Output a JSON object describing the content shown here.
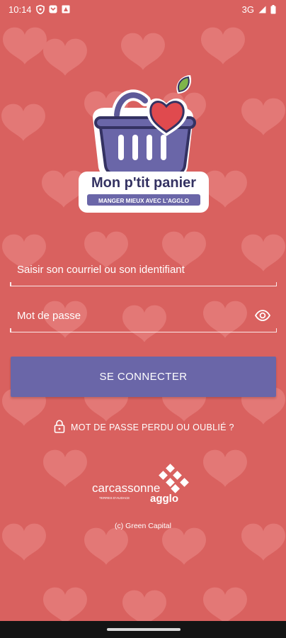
{
  "status_bar": {
    "time": "10:14",
    "network": "3G",
    "left_icons": [
      "shield-icon",
      "notification-icon",
      "app-icon"
    ],
    "right_icons": [
      "signal-icon",
      "battery-icon"
    ]
  },
  "logo": {
    "title": "Mon p'tit panier",
    "tagline": "MANGER MIEUX AVEC L'AGGLO"
  },
  "login": {
    "identifier_placeholder": "Saisir son courriel ou son identifiant",
    "password_placeholder": "Mot de passe",
    "connect_label": "SE CONNECTER",
    "forgot_label": "MOT DE PASSE PERDU OU OUBLIÉ ?"
  },
  "footer": {
    "partner_name": "carcassonne",
    "partner_subname": "agglo",
    "partner_slogan": "TERRES D'AUDACE",
    "copyright": "(c) Green Capital"
  },
  "colors": {
    "background": "#d9615f",
    "heart": "#e6807e",
    "button": "#6a66a8",
    "basket": "#6a66a8",
    "logo_heart": "#e04a4e"
  }
}
